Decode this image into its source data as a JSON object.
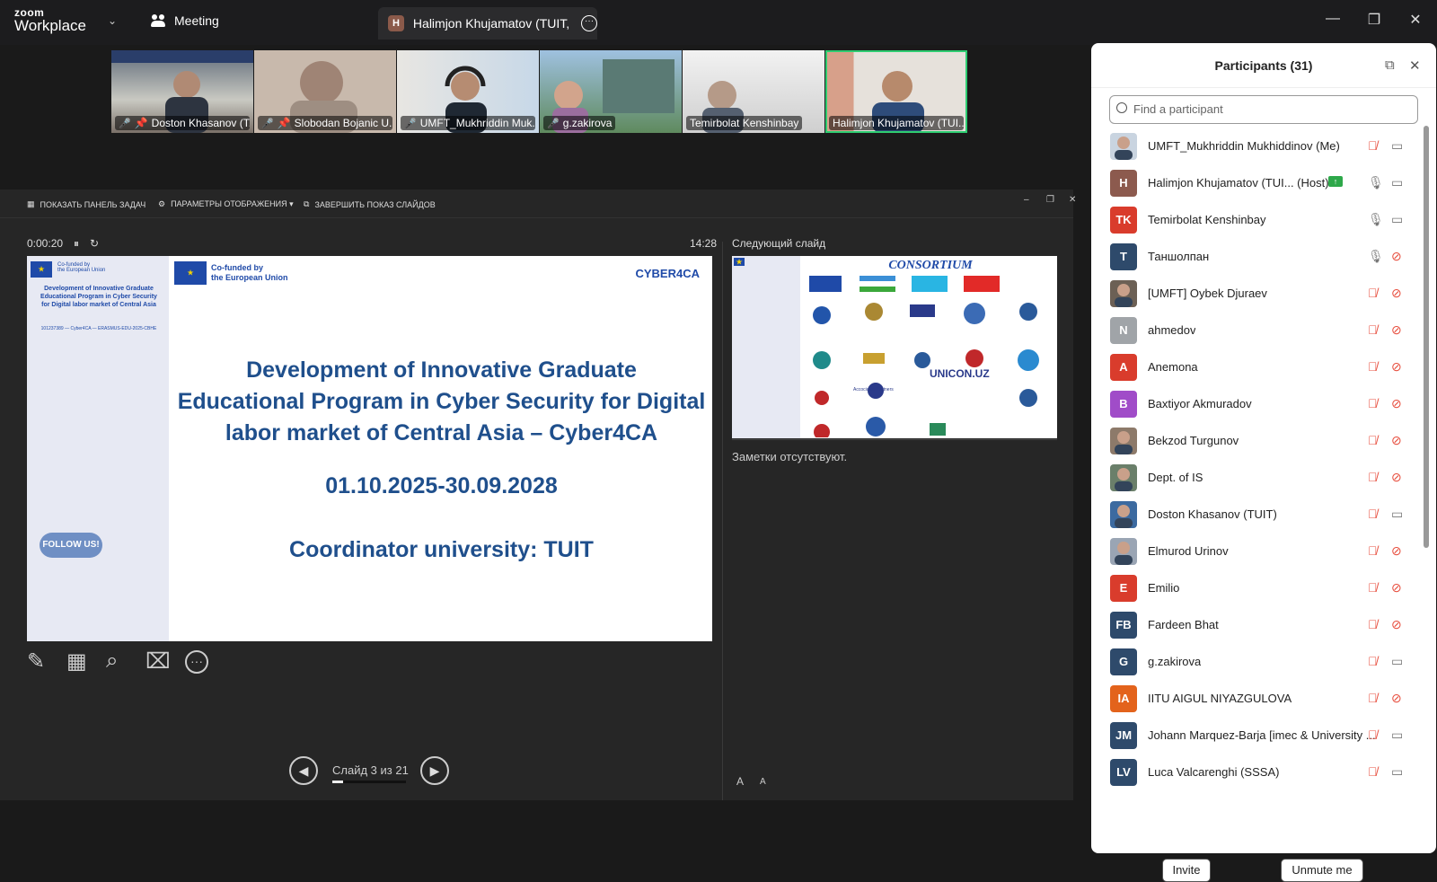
{
  "titlebar": {
    "logo_top": "zoom",
    "logo_bottom": "Workplace",
    "meeting_label": "Meeting",
    "active_tab_avatar": "H",
    "active_tab_title": "Halimjon Khujamatov (TUIT, Uzbe"
  },
  "video_tiles": [
    {
      "name": "Doston Khasanov (T...",
      "muted": true,
      "pinned": true
    },
    {
      "name": "Slobodan Bojanic U...",
      "muted": true,
      "pinned": true
    },
    {
      "name": "UMFT_Mukhriddin Muk...",
      "muted": true
    },
    {
      "name": "g.zakirova",
      "muted": true
    },
    {
      "name": "Temirbolat Kenshinbay",
      "muted": false
    },
    {
      "name": "Halimjon Khujamatov (TUI...",
      "muted": false,
      "speaking": true
    }
  ],
  "slideshow": {
    "toolbar": [
      "ПОКАЗАТЬ ПАНЕЛЬ ЗАДАЧ",
      "ПАРАМЕТРЫ ОТОБРАЖЕНИЯ ▾",
      "ЗАВЕРШИТЬ ПОКАЗ СЛАЙДОВ"
    ],
    "elapsed": "0:00:20",
    "clock": "14:28",
    "next_slide_label": "Следующий слайд",
    "notes": "Заметки отсутствуют.",
    "slide_counter": "Слайд 3 из 21",
    "progress_fraction": 0.143
  },
  "current_slide": {
    "eu_text": "Co-funded by\nthe European Union",
    "brand": "CYBER4CA",
    "side_title": "Development of Innovative Graduate Educational Program in Cyber Security for Digital labor market of Central Asia",
    "side_ref": "101237389 — Cyber4CA — ERASMUS-EDU-2025-CBHE",
    "follow": "FOLLOW US!",
    "title_line1": "Development of Innovative Graduate",
    "title_line2": "Educational Program  in Cyber Security for Digital",
    "title_line3": "labor market of Central Asia – Cyber4CA",
    "dates": "01.10.2025-30.09.2028",
    "coordinator": "Coordinator university: TUIT"
  },
  "next_slide": {
    "heading": "CONSORTIUM",
    "partner1": "UNICON.UZ",
    "partner2": "Accociated Partners"
  },
  "participants": {
    "title": "Participants (31)",
    "search_placeholder": "Find a participant",
    "invite": "Invite",
    "unmute": "Unmute me",
    "list": [
      {
        "name": "UMFT_Mukhriddin Mukhiddinov (Me)",
        "initials": "",
        "color": "#c9d4e0",
        "photo": true,
        "mic": "muted",
        "cam": "on"
      },
      {
        "name": "Halimjon Khujamatov (TUI...   (Host)",
        "initials": "H",
        "color": "#8c5a4e",
        "photo": false,
        "mic": "on",
        "cam": "on",
        "sharing": true
      },
      {
        "name": "Temirbolat Kenshinbay",
        "initials": "TK",
        "color": "#d93c2c",
        "photo": false,
        "mic": "on",
        "cam": "on"
      },
      {
        "name": "Таншолпан",
        "initials": "T",
        "color": "#2e4a6b",
        "photo": false,
        "mic": "on",
        "cam": "off"
      },
      {
        "name": "[UMFT] Oybek Djuraev",
        "initials": "",
        "color": "#6c6055",
        "photo": true,
        "mic": "muted",
        "cam": "off"
      },
      {
        "name": "ahmedov",
        "initials": "N",
        "color": "#a0a4a8",
        "photo": false,
        "mic": "muted",
        "cam": "off"
      },
      {
        "name": "Anemona",
        "initials": "A",
        "color": "#d93c2c",
        "photo": false,
        "mic": "muted",
        "cam": "off"
      },
      {
        "name": "Baxtiyor Akmuradov",
        "initials": "B",
        "color": "#a04cc8",
        "photo": false,
        "mic": "muted",
        "cam": "off"
      },
      {
        "name": "Bekzod Turgunov",
        "initials": "",
        "color": "#8d7a6a",
        "photo": true,
        "mic": "muted",
        "cam": "off"
      },
      {
        "name": "Dept. of IS",
        "initials": "",
        "color": "#6a7f6a",
        "photo": true,
        "mic": "muted",
        "cam": "off"
      },
      {
        "name": "Doston Khasanov (TUIT)",
        "initials": "",
        "color": "#3c6aa0",
        "photo": true,
        "mic": "muted",
        "cam": "on"
      },
      {
        "name": "Elmurod Urinov",
        "initials": "",
        "color": "#9aa5b4",
        "photo": true,
        "mic": "muted",
        "cam": "off"
      },
      {
        "name": "Emilio",
        "initials": "E",
        "color": "#d93c2c",
        "photo": false,
        "mic": "muted",
        "cam": "off"
      },
      {
        "name": "Fardeen Bhat",
        "initials": "FB",
        "color": "#2e4a6b",
        "photo": false,
        "mic": "muted",
        "cam": "off"
      },
      {
        "name": "g.zakirova",
        "initials": "G",
        "color": "#2e4a6b",
        "photo": false,
        "mic": "muted",
        "cam": "on"
      },
      {
        "name": "IITU AIGUL NIYAZGULOVA",
        "initials": "IA",
        "color": "#e3631c",
        "photo": false,
        "mic": "muted",
        "cam": "off"
      },
      {
        "name": "Johann Marquez-Barja [imec & University ...",
        "initials": "JM",
        "color": "#2e4a6b",
        "photo": false,
        "mic": "muted",
        "cam": "on"
      },
      {
        "name": "Luca Valcarenghi (SSSA)",
        "initials": "LV",
        "color": "#2e4a6b",
        "photo": false,
        "mic": "muted",
        "cam": "on"
      }
    ]
  },
  "colors": {
    "speaking": "#2ecc71",
    "muted": "#e74c3c",
    "slide_title": "#1f4f8c"
  }
}
